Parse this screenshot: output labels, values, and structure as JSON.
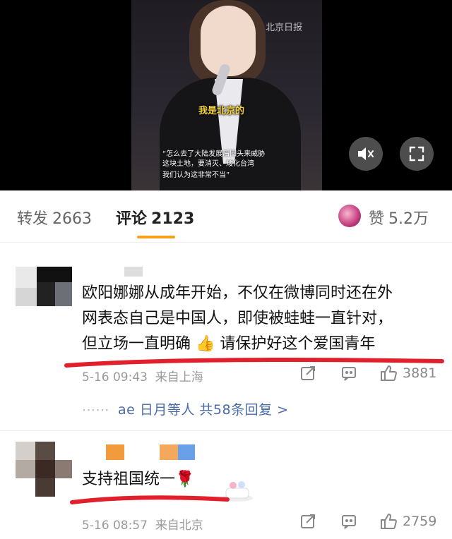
{
  "video": {
    "watermark": "北京日报",
    "highlight_caption": "我是北京的",
    "subtitle_lines": [
      "“怎么去了大陆发展后回头来威胁",
      "这块土地，要消灭、矮化台湾",
      "我们认为这非常不当”"
    ],
    "mute_icon": "speaker-muted-icon",
    "fullscreen_icon": "fullscreen-icon"
  },
  "tabs": {
    "repost_label": "转发",
    "repost_count": "2663",
    "comment_label": "评论",
    "comment_count": "2123",
    "like_label": "赞",
    "like_count": "5.2万"
  },
  "comments": [
    {
      "text_line1": "欧阳娜娜从成年开始，不仅在微博同时还在外",
      "text_line2": "网表态自己是中国人，即使被蛙蛙一直针对，",
      "text_line3a": "但立场一直明确",
      "emoji": "👍",
      "text_line3b": "请保护好这个爱国青年",
      "time": "5-16 09:43",
      "location": "来自上海",
      "likes": "3881",
      "reply_summary": "ae 日月等人 共58条回复 >"
    },
    {
      "text": "支持祖国统一",
      "emoji": "🌹",
      "time": "5-16 08:57",
      "location": "来自北京",
      "likes": "2759"
    }
  ],
  "colors": {
    "accent_orange": "#f5a11c",
    "link_blue": "#4a6aa8",
    "red_underline": "#e2202c"
  }
}
